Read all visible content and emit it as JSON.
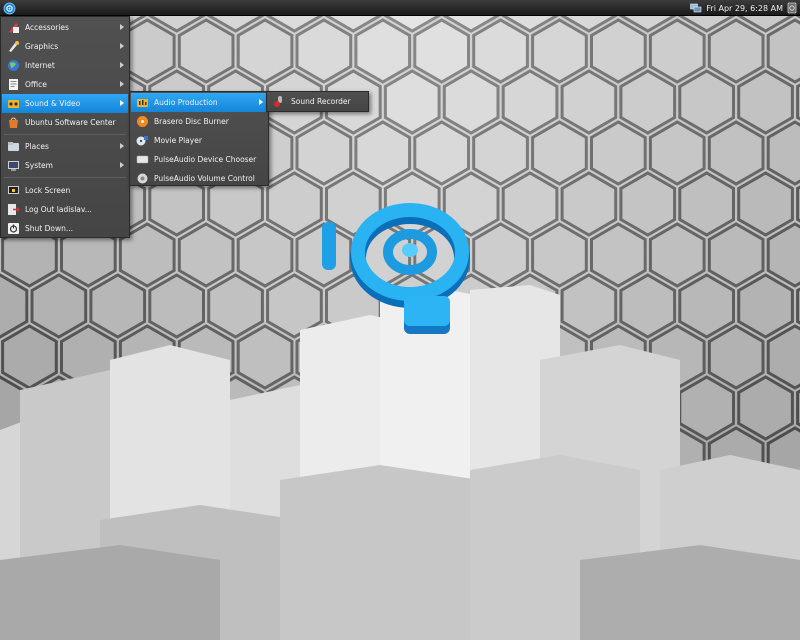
{
  "panel": {
    "menu_icon": "ubuntu-logo-icon",
    "clock": "Fri Apr 29,  6:28 AM",
    "tray_icons": [
      "network-icon",
      "session-icon"
    ]
  },
  "main_menu": {
    "items": [
      {
        "label": "Accessories",
        "icon": "accessories-icon"
      },
      {
        "label": "Graphics",
        "icon": "graphics-icon"
      },
      {
        "label": "Internet",
        "icon": "internet-icon"
      },
      {
        "label": "Office",
        "icon": "office-icon"
      },
      {
        "label": "Sound & Video",
        "icon": "sound-video-icon"
      },
      {
        "label": "Ubuntu Software Center",
        "icon": "software-center-icon"
      },
      {
        "label": "Places",
        "icon": "places-icon"
      },
      {
        "label": "System",
        "icon": "system-icon"
      },
      {
        "label": "Lock Screen",
        "icon": "lock-screen-icon"
      },
      {
        "label": "Log Out ladislav...",
        "icon": "log-out-icon"
      },
      {
        "label": "Shut Down...",
        "icon": "shut-down-icon"
      }
    ]
  },
  "sound_video_menu": {
    "items": [
      {
        "label": "Audio Production",
        "icon": "audio-production-icon"
      },
      {
        "label": "Brasero Disc Burner",
        "icon": "brasero-icon"
      },
      {
        "label": "Movie Player",
        "icon": "movie-player-icon"
      },
      {
        "label": "PulseAudio Device Chooser",
        "icon": "pulseaudio-device-icon"
      },
      {
        "label": "PulseAudio Volume Control",
        "icon": "pulseaudio-volume-icon"
      }
    ]
  },
  "audio_production_menu": {
    "items": [
      {
        "label": "Sound Recorder",
        "icon": "sound-recorder-icon"
      }
    ]
  },
  "colors": {
    "highlight": "#1e95e8",
    "menu_bg": "#4a4a4a",
    "panel_bg": "#262626"
  }
}
